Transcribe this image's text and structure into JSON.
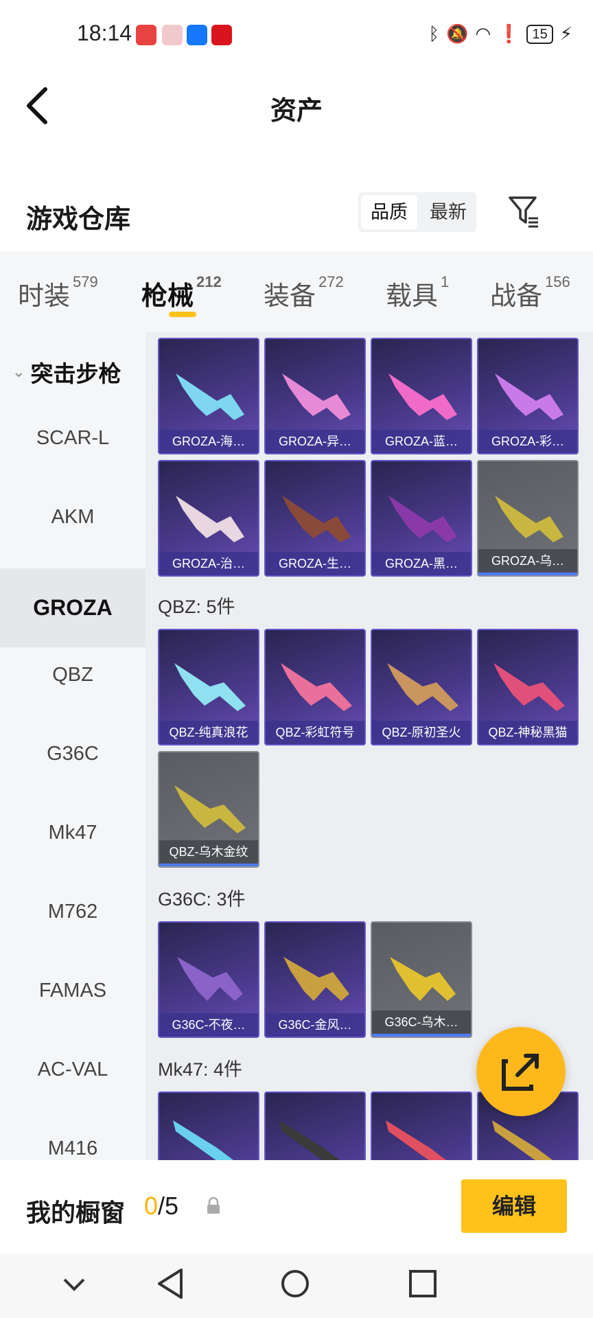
{
  "status_bar": {
    "time": "18:14",
    "battery": "15"
  },
  "header": {
    "title": "资产"
  },
  "warehouse": {
    "title": "游戏仓库",
    "sort_options": [
      "品质",
      "最新"
    ],
    "selected_sort": "品质"
  },
  "tabs": [
    {
      "label": "时装",
      "count": "579"
    },
    {
      "label": "枪械",
      "count": "212"
    },
    {
      "label": "装备",
      "count": "272"
    },
    {
      "label": "载具",
      "count": "1"
    },
    {
      "label": "战备",
      "count": "156"
    }
  ],
  "active_tab": "枪械",
  "sidebar": {
    "category": "突击步枪",
    "items": [
      "SCAR-L",
      "AKM",
      "GROZA",
      "QBZ",
      "G36C",
      "Mk47",
      "M762",
      "FAMAS",
      "AC-VAL",
      "M416"
    ],
    "active": "GROZA"
  },
  "groups": [
    {
      "title": "",
      "items": [
        "GROZA-海…",
        "GROZA-异…",
        "GROZA-蓝…",
        "GROZA-彩…",
        "GROZA-治…",
        "GROZA-生…",
        "GROZA-黑…",
        "GROZA-乌…"
      ]
    },
    {
      "title": "QBZ: 5件",
      "items": [
        "QBZ-纯真浪花",
        "QBZ-彩虹符号",
        "QBZ-原初圣火",
        "QBZ-神秘黑猫",
        "QBZ-乌木金纹"
      ]
    },
    {
      "title": "G36C: 3件",
      "items": [
        "G36C-不夜…",
        "G36C-金风…",
        "G36C-乌木…"
      ]
    },
    {
      "title": "Mk47: 4件",
      "items": [
        "",
        "",
        "",
        ""
      ]
    }
  ],
  "showcase": {
    "label": "我的橱窗",
    "current": "0",
    "total": "/5",
    "edit_label": "编辑"
  },
  "colors": {
    "accent": "#ffc21a",
    "card_purple": "#4a3a8c",
    "card_grey": "#65676d"
  }
}
